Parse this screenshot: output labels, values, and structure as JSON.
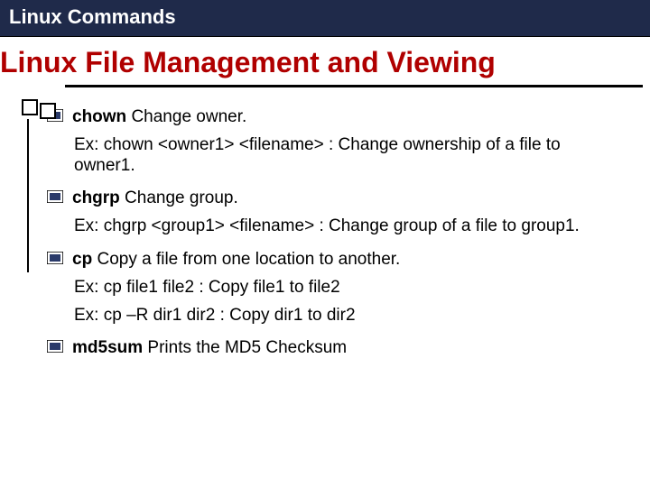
{
  "titlebar": "Linux Commands",
  "heading": "Linux File Management and Viewing",
  "items": [
    {
      "cmd": "chown",
      "desc": " Change owner.",
      "examples": [
        " Ex: chown <owner1> <filename> : Change ownership of a file to owner1."
      ]
    },
    {
      "cmd": "chgrp",
      "desc": " Change group.",
      "examples": [
        " Ex: chgrp <group1> <filename> : Change group of a file to group1."
      ]
    },
    {
      "cmd": "cp",
      "desc": " Copy a file from one location to another.",
      "examples": [
        " Ex: cp file1 file2 : Copy file1 to file2",
        " Ex: cp –R dir1 dir2 : Copy dir1 to dir2"
      ]
    },
    {
      "cmd": "md5sum",
      "desc": " Prints the MD5 Checksum",
      "examples": []
    }
  ]
}
